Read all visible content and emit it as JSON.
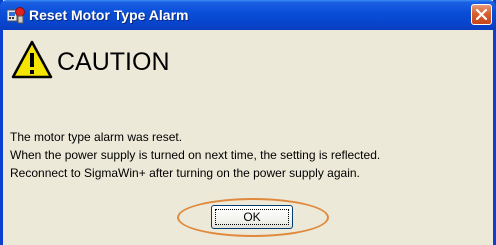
{
  "window": {
    "title": "Reset Motor Type Alarm",
    "app_icon": "motor-app-icon",
    "close_icon": "close-icon"
  },
  "caution": {
    "icon": "warning-triangle-icon",
    "heading": "CAUTION"
  },
  "message": {
    "lines": [
      "The motor type alarm was reset.",
      "When the power supply is turned on next time, the setting is reflected.",
      "Reconnect to SigmaWin+ after turning on the power supply again."
    ]
  },
  "buttons": {
    "ok_label": "OK"
  },
  "colors": {
    "titlebar": "#0a4fd8",
    "dialog_background": "#ece9d8",
    "close_button": "#d8602f",
    "highlight_ellipse": "#e0893c",
    "warning_fill": "#f5e400"
  }
}
